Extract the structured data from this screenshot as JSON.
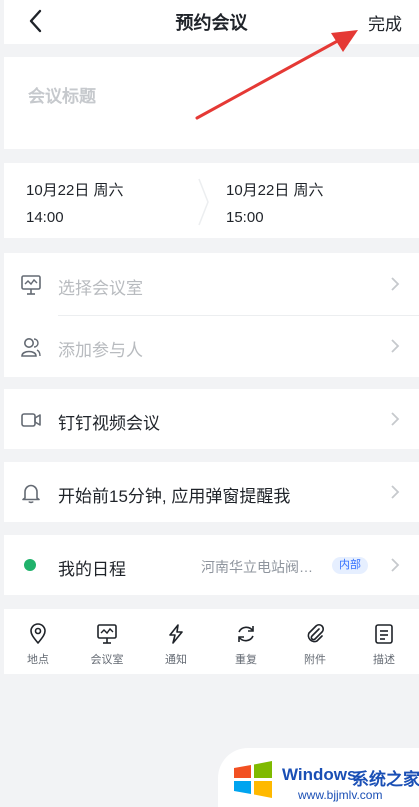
{
  "header": {
    "title": "预约会议",
    "done_label": "完成"
  },
  "meeting_title": {
    "placeholder": "会议标题"
  },
  "time": {
    "start_date": "10月22日 周六",
    "start_time": "14:00",
    "end_date": "10月22日 周六",
    "end_time": "15:00"
  },
  "rows": {
    "room_label": "选择会议室",
    "participants_label": "添加参与人",
    "video_label": "钉钉视频会议",
    "reminder_label": "开始前15分钟, 应用弹窗提醒我",
    "calendar_label": "我的日程",
    "calendar_location": "河南华立电站阀…",
    "calendar_badge": "内部"
  },
  "toolbar": {
    "items": [
      {
        "label": "地点",
        "icon": "location-icon"
      },
      {
        "label": "会议室",
        "icon": "meeting-room-icon"
      },
      {
        "label": "通知",
        "icon": "lightning-icon"
      },
      {
        "label": "重复",
        "icon": "repeat-icon"
      },
      {
        "label": "附件",
        "icon": "paperclip-icon"
      },
      {
        "label": "描述",
        "icon": "description-icon"
      }
    ]
  },
  "watermark": {
    "brand": "Windows",
    "cn": "系统之家",
    "url": "www.bjjmlv.com"
  },
  "colors": {
    "accent": "#3370ff",
    "calendar_dot": "#20b26b",
    "annotation_arrow": "#e53935",
    "background": "#f2f3f5"
  }
}
